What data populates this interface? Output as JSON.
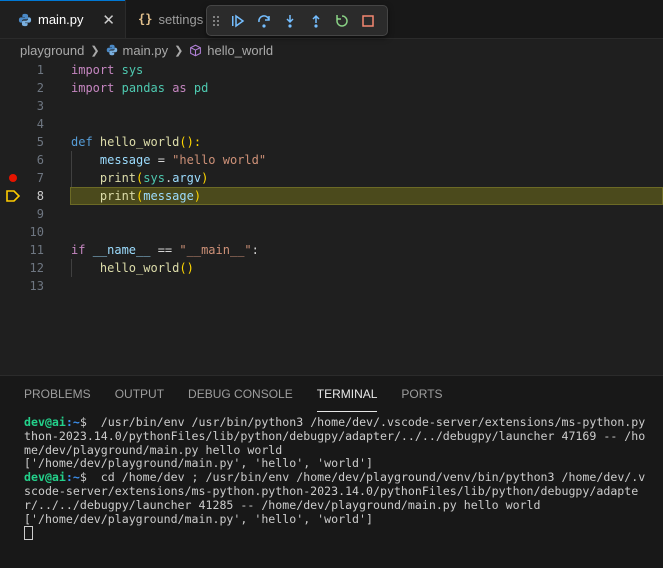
{
  "tabs": [
    {
      "label": "main.py",
      "close": "✕",
      "icon": "python-icon"
    },
    {
      "label": "settings",
      "icon": "json-braces-icon",
      "brace": "{}"
    }
  ],
  "debug_toolbar": [
    "drag-handle-icon",
    "continue-icon",
    "step-over-icon",
    "step-into-icon",
    "step-out-icon",
    "restart-icon",
    "stop-icon"
  ],
  "breadcrumb": {
    "folder": "playground",
    "file": "main.py",
    "symbol": "hello_world"
  },
  "editor": {
    "line_numbers": [
      "1",
      "2",
      "3",
      "4",
      "5",
      "6",
      "7",
      "8",
      "9",
      "10",
      "11",
      "12",
      "13"
    ],
    "current_line": "8",
    "breakpoint_line": "7",
    "tokens": {
      "l1": [
        "import",
        " ",
        "sys"
      ],
      "l2": [
        "import",
        " ",
        "pandas",
        " ",
        "as",
        " ",
        "pd"
      ],
      "l5": [
        "def",
        " ",
        "hello_world",
        "():"
      ],
      "l6": [
        "    ",
        "message",
        " = ",
        "\"hello world\""
      ],
      "l7": [
        "    ",
        "print",
        "(",
        "sys",
        ".",
        "argv",
        ")"
      ],
      "l8": [
        "    ",
        "print",
        "(",
        "message",
        ")"
      ],
      "l11": [
        "if",
        " ",
        "__name__",
        " == ",
        "\"__main__\"",
        ":"
      ],
      "l12": [
        "    ",
        "hello_world",
        "()"
      ]
    }
  },
  "panel": {
    "tabs": [
      "PROBLEMS",
      "OUTPUT",
      "DEBUG CONSOLE",
      "TERMINAL",
      "PORTS"
    ],
    "active_tab": "TERMINAL"
  },
  "terminal": {
    "user": "dev@ai",
    "path": ":~",
    "prompt_symbol": "$",
    "cmd1": "  /usr/bin/env /usr/bin/python3 /home/dev/.vscode-server/extensions/ms-python.python-2023.14.0/pythonFiles/lib/python/debugpy/adapter/../../debugpy/launcher 47169 -- /home/dev/playground/main.py hello world",
    "out1": "['/home/dev/playground/main.py', 'hello', 'world']",
    "cmd2": "  cd /home/dev ; /usr/bin/env /home/dev/playground/venv/bin/python3 /home/dev/.vscode-server/extensions/ms-python.python-2023.14.0/pythonFiles/lib/python/debugpy/adapter/../../debugpy/launcher 41285 -- /home/dev/playground/main.py hello world",
    "out2": "['/home/dev/playground/main.py', 'hello', 'world']"
  }
}
